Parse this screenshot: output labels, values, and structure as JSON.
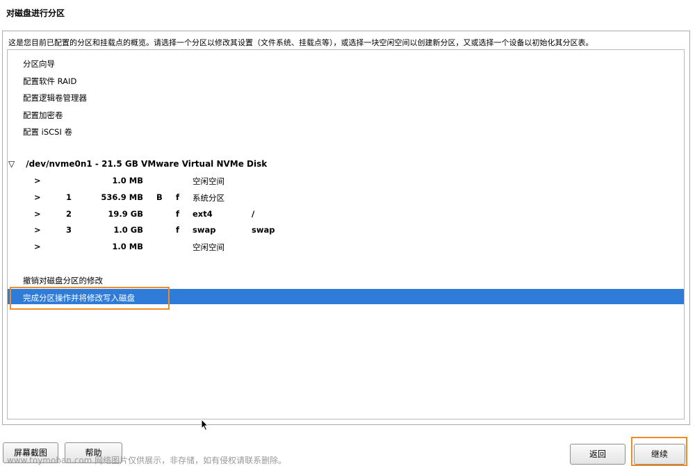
{
  "window": {
    "title": "对磁盘进行分区"
  },
  "description": "这是您目前已配置的分区和挂载点的概览。请选择一个分区以修改其设置（文件系统、挂载点等），或选择一块空闲空间以创建新分区，又或选择一个设备以初始化其分区表。",
  "menu_items": [
    "分区向导",
    "配置软件 RAID",
    "配置逻辑卷管理器",
    "配置加密卷",
    "配置 iSCSI 卷"
  ],
  "device": {
    "expander": "▽",
    "label": "/dev/nvme0n1 - 21.5 GB VMware Virtual NVMe Disk"
  },
  "partitions": [
    {
      "arrow": ">",
      "num": "",
      "size": "1.0 MB",
      "boot": "",
      "fsflag": "",
      "type": "空闲空间",
      "mount": ""
    },
    {
      "arrow": ">",
      "num": "1",
      "size": "536.9 MB",
      "boot": "B",
      "fsflag": "f",
      "type": "系统分区",
      "mount": ""
    },
    {
      "arrow": ">",
      "num": "2",
      "size": "19.9 GB",
      "boot": "",
      "fsflag": "f",
      "type": "ext4",
      "mount": "/"
    },
    {
      "arrow": ">",
      "num": "3",
      "size": "1.0 GB",
      "boot": "",
      "fsflag": "f",
      "type": "swap",
      "mount": "swap"
    },
    {
      "arrow": ">",
      "num": "",
      "size": "1.0 MB",
      "boot": "",
      "fsflag": "",
      "type": "空闲空间",
      "mount": ""
    }
  ],
  "actions": {
    "undo": "撤销对磁盘分区的修改",
    "finish": "完成分区操作并将修改写入磁盘"
  },
  "buttons": {
    "screenshot": "屏幕截图",
    "help": "帮助",
    "back": "返回",
    "continue": "继续"
  },
  "watermark": "www.toymoban.com 网络图片仅供展示，非存储，如有侵权请联系删除。",
  "colors": {
    "selection": "#2f7bd8",
    "highlight": "#f08a24"
  }
}
